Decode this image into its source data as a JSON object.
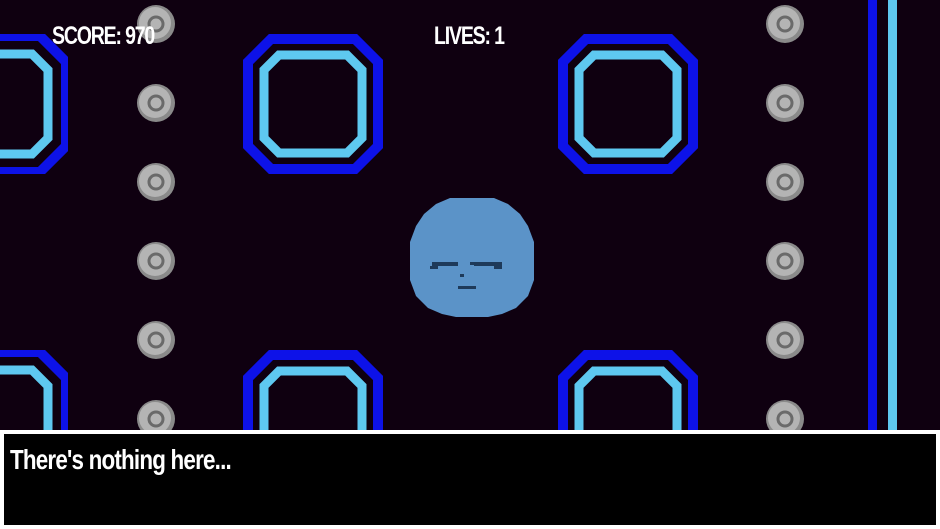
{
  "hud": {
    "score_label": "SCORE: 970",
    "lives_label": "LIVES: 1"
  },
  "dialog": {
    "text": "There's nothing here..."
  },
  "colors": {
    "background": "#0f0010",
    "wall_dark": "#0d12e8",
    "wall_light": "#5ec8f0",
    "coin": "#b4b4b4",
    "player": "#5b93c8",
    "player_face": "#1e3a5a"
  },
  "sprites": {
    "player": "blue-blob-character",
    "pellet": "silver-coin",
    "maze_block": "blue-rounded-square-wall"
  }
}
